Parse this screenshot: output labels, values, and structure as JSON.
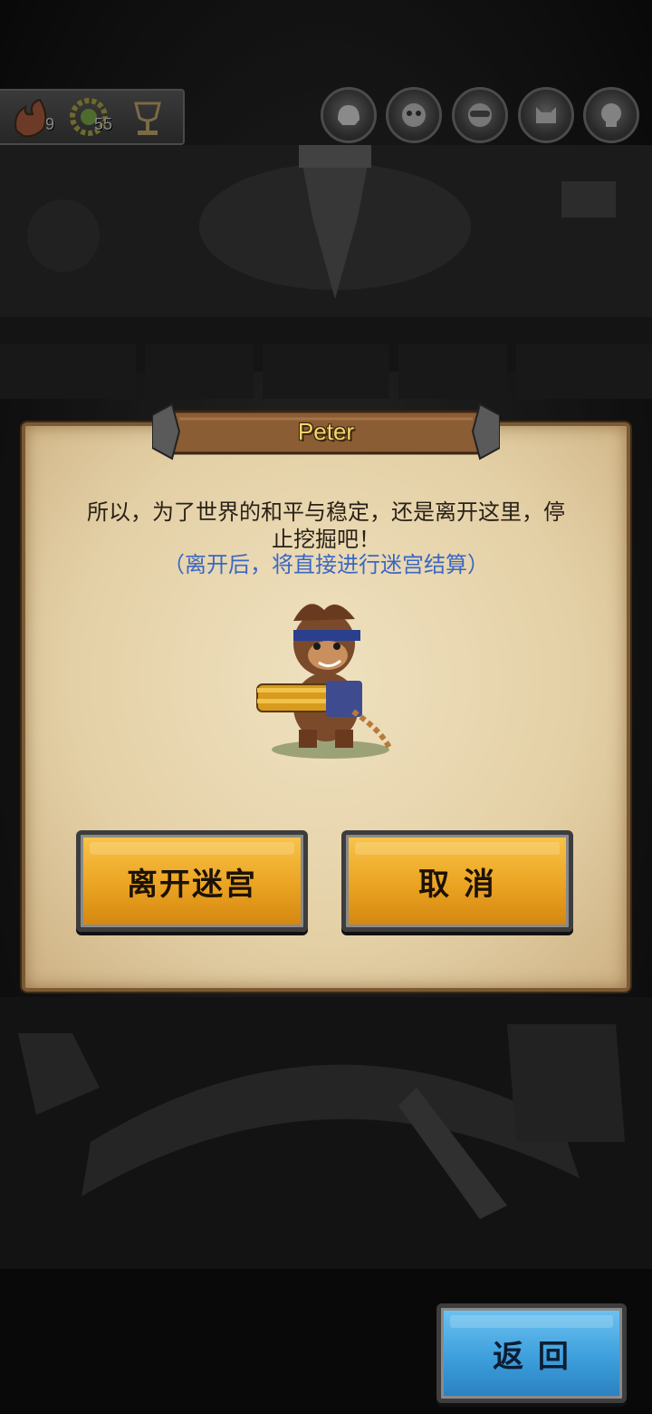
{
  "resources": [
    {
      "icon": "flame-icon",
      "count": "9"
    },
    {
      "icon": "gear-laurel-icon",
      "count": "55"
    },
    {
      "icon": "trophy-icon",
      "count": ""
    }
  ],
  "bosses": [
    "boss-token-1",
    "boss-token-2",
    "boss-token-3",
    "boss-token-4",
    "boss-token-5"
  ],
  "dialog": {
    "title": "Peter",
    "message": "所以，为了世界的和平与稳定，还是离开这里，停止挖掘吧！",
    "note": "（离开后，将直接进行迷宫结算）",
    "leave_label": "离开迷宫",
    "cancel_label": "取 消"
  },
  "footer": {
    "back_label": "返 回"
  },
  "colors": {
    "gold_button": "#eba322",
    "blue_button": "#3d9fdc",
    "note_text": "#3b67c4",
    "title_text": "#f3d76a"
  }
}
